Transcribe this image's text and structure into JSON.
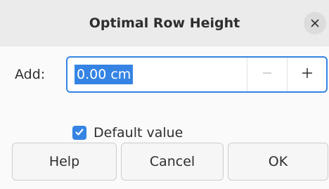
{
  "window": {
    "title": "Optimal Row Height",
    "close_icon": "close-icon"
  },
  "form": {
    "add_label": "Add:",
    "add_value": "0.00 cm",
    "decrement_icon": "minus-icon",
    "increment_icon": "plus-icon",
    "default_value_label": "Default value",
    "default_value_checked": true
  },
  "buttons": {
    "help": "Help",
    "cancel": "Cancel",
    "ok": "OK"
  },
  "colors": {
    "accent": "#3584e4",
    "titlebar": "#ebebeb",
    "background": "#fafafa"
  }
}
